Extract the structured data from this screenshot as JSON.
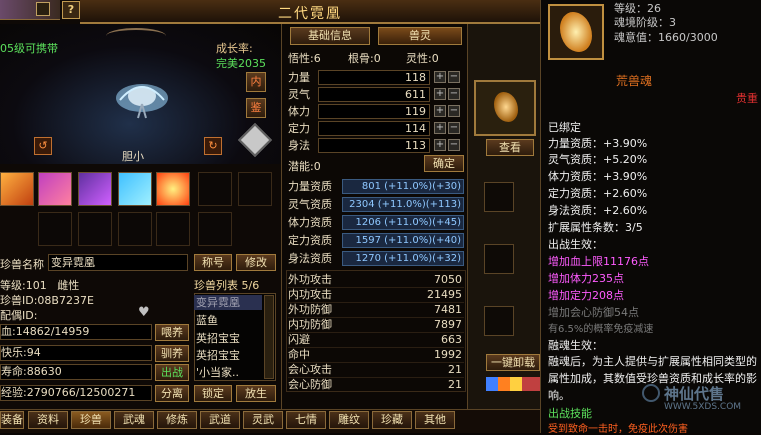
{
  "header": {
    "title": "二代霓凰",
    "help": "?"
  },
  "left": {
    "carry_level": "05级可携带",
    "growth_label": "成长率:",
    "growth_value": "完美2035",
    "btn_nei": "内",
    "btn_jian": "鉴",
    "pet_temper": "胆小",
    "pet_name_label": "珍兽名称",
    "pet_name_value": "变异霓凰",
    "btn_title": "称号",
    "btn_modify": "修改",
    "level_line": "等级:101   雌性",
    "id_line": "珍兽ID:08B7237E",
    "mate_line": "配偶ID:",
    "hp_line": "血:14862/14959",
    "happy_line": "快乐:94",
    "life_line": "寿命:88630",
    "exp_line": "经验:2790766/12500271",
    "btn_feed": "喂养",
    "btn_tame": "驯养",
    "btn_battle": "出战",
    "btn_split": "分离",
    "btn_lock": "锁定",
    "btn_release": "放生",
    "list_title": "珍兽列表 5/6",
    "list": [
      "变异霓凰",
      "蓝鱼",
      "英招宝宝",
      "英招宝宝",
      "'小当家.."
    ]
  },
  "mid": {
    "tabs": [
      "基础信息",
      "兽灵"
    ],
    "wuxing": "悟性:6",
    "gengu": "根骨:0",
    "lingxing": "灵性:0",
    "attrs": [
      {
        "label": "力量",
        "value": "118"
      },
      {
        "label": "灵气",
        "value": "611"
      },
      {
        "label": "体力",
        "value": "119"
      },
      {
        "label": "定力",
        "value": "114"
      },
      {
        "label": "身法",
        "value": "113"
      }
    ],
    "potential": "潜能:0",
    "btn_confirm": "确定",
    "aptitudes": [
      {
        "label": "力量资质",
        "value": "801 (+11.0%)(+30)"
      },
      {
        "label": "灵气资质",
        "value": "2304 (+11.0%)(+113)"
      },
      {
        "label": "体力资质",
        "value": "1206 (+11.0%)(+45)"
      },
      {
        "label": "定力资质",
        "value": "1597 (+11.0%)(+40)"
      },
      {
        "label": "身法资质",
        "value": "1270 (+11.0%)(+32)"
      }
    ],
    "combat": [
      {
        "label": "外功攻击",
        "value": "7050"
      },
      {
        "label": "内功攻击",
        "value": "21495"
      },
      {
        "label": "外功防御",
        "value": "7481"
      },
      {
        "label": "内功防御",
        "value": "7897"
      },
      {
        "label": "闪避",
        "value": "663"
      },
      {
        "label": "命中",
        "value": "1992"
      },
      {
        "label": "会心攻击",
        "value": "21"
      },
      {
        "label": "会心防御",
        "value": "21"
      }
    ],
    "btn_view": "查看",
    "btn_unload": "一键卸载"
  },
  "right": {
    "level_line": "等级：26",
    "stage_line": "魂境阶级：3",
    "soul_line": "魂意值：1660/3000",
    "soul_name": "荒兽魂",
    "rare": "贵重",
    "bound": "已绑定",
    "stats": [
      "力量资质：+3.90%",
      "灵气资质：+5.20%",
      "体力资质：+3.90%",
      "定力资质：+2.60%",
      "身法资质：+2.60%"
    ],
    "ext_count": "扩展属性条数：3/5",
    "effect_title": "出战生效：",
    "effects": [
      "增加血上限11176点",
      "增加体力235点",
      "增加定力208点"
    ],
    "effects_grey": [
      "增加会心防御54点",
      "有6.5%的概率免疫减速"
    ],
    "fusion_title": "融魂生效：",
    "fusion_text": "融魂后，为主人提供与扩展属性相同类型的属性加成，其数值受珍兽资质和成长率的影响。",
    "battle_skill": "出战技能",
    "bottom_text": "受到致命一击时，免疫此次伤害"
  },
  "bottom_tabs": [
    "装备",
    "资料",
    "珍兽",
    "武魂",
    "修炼",
    "武道",
    "灵武",
    "七情",
    "雕纹",
    "珍藏",
    "其他"
  ],
  "watermark": {
    "name": "神仙代售",
    "url": "WWW.5XDS.COM"
  }
}
